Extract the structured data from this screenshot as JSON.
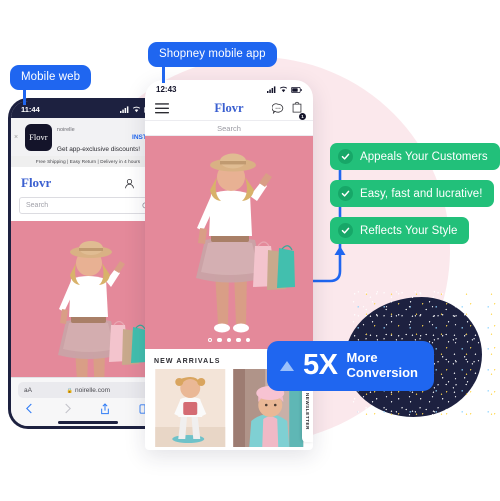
{
  "colors": {
    "brand_blue": "#1f66f0",
    "green": "#22c07a",
    "green_dark": "#17a768",
    "navy": "#1d2140",
    "pink_bg": "#fbe8ec",
    "hero_pink": "#e4899a"
  },
  "labels": {
    "mobile_web": "Mobile web",
    "shopney_app": "Shopney mobile app"
  },
  "mobile_web": {
    "status_time": "11:44",
    "smart_banner": {
      "close": "×",
      "logo_text": "Flovr",
      "app_name": "noirelle",
      "subtitle": "Get app-exclusive discounts!",
      "install_label": "INSTALL"
    },
    "ticker": "Free Shipping | Easy Return | Delivery in 4 hours",
    "brand": "Flovr",
    "search_placeholder": "Search",
    "url": "noirelle.com",
    "url_prefix": "🔒",
    "text_size_label": "aA"
  },
  "shopney_app": {
    "status_time": "12:43",
    "brand": "Flovr",
    "search_placeholder": "Search",
    "cart_badge": "1",
    "carousel_dots": 5,
    "carousel_active_index": 0,
    "section_title": "NEW ARRIVALS",
    "side_tab_label": "NEWSLETTER"
  },
  "features": [
    {
      "label": "Appeals Your Customers",
      "check": "✓"
    },
    {
      "label": "Easy, fast and lucrative!",
      "check": "✓"
    },
    {
      "label": "Reflects Your Style",
      "check": "✓"
    }
  ],
  "conversion_badge": {
    "multiplier": "5X",
    "line1": "More",
    "line2": "Conversion"
  }
}
